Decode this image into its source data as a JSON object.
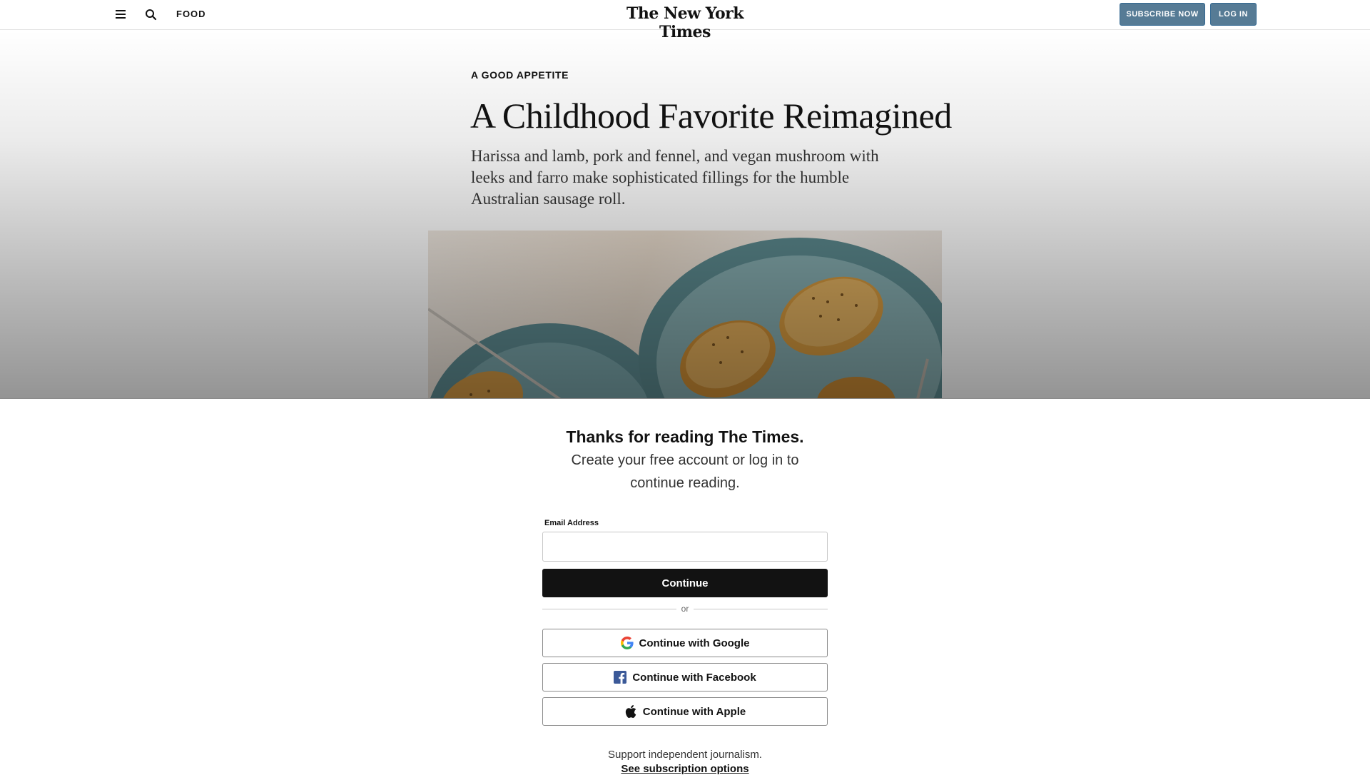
{
  "header": {
    "section_label": "FOOD",
    "masthead": "The New York Times",
    "subscribe_label": "SUBSCRIBE NOW",
    "login_label": "LOG IN",
    "icons": [
      "menu-icon",
      "search-icon"
    ]
  },
  "article": {
    "kicker": "A GOOD APPETITE",
    "headline": "A Childhood Favorite Reimagined",
    "summary": "Harissa and lamb, pork and fennel, and vegan mushroom with leeks and farro make sophisticated fillings for the humble Australian sausage roll."
  },
  "registration": {
    "title": "Thanks for reading The Times.",
    "subtitle": "Create your free account or log in to continue reading.",
    "email_label": "Email Address",
    "email_value": "",
    "continue_label": "Continue",
    "divider_text": "or",
    "google_label": "Continue with Google",
    "facebook_label": "Continue with Facebook",
    "apple_label": "Continue with Apple",
    "support_text": "Support independent journalism.",
    "subscription_link": "See subscription options"
  },
  "colors": {
    "header_button": "#567b95",
    "continue_button": "#121212",
    "facebook": "#3b5998"
  }
}
